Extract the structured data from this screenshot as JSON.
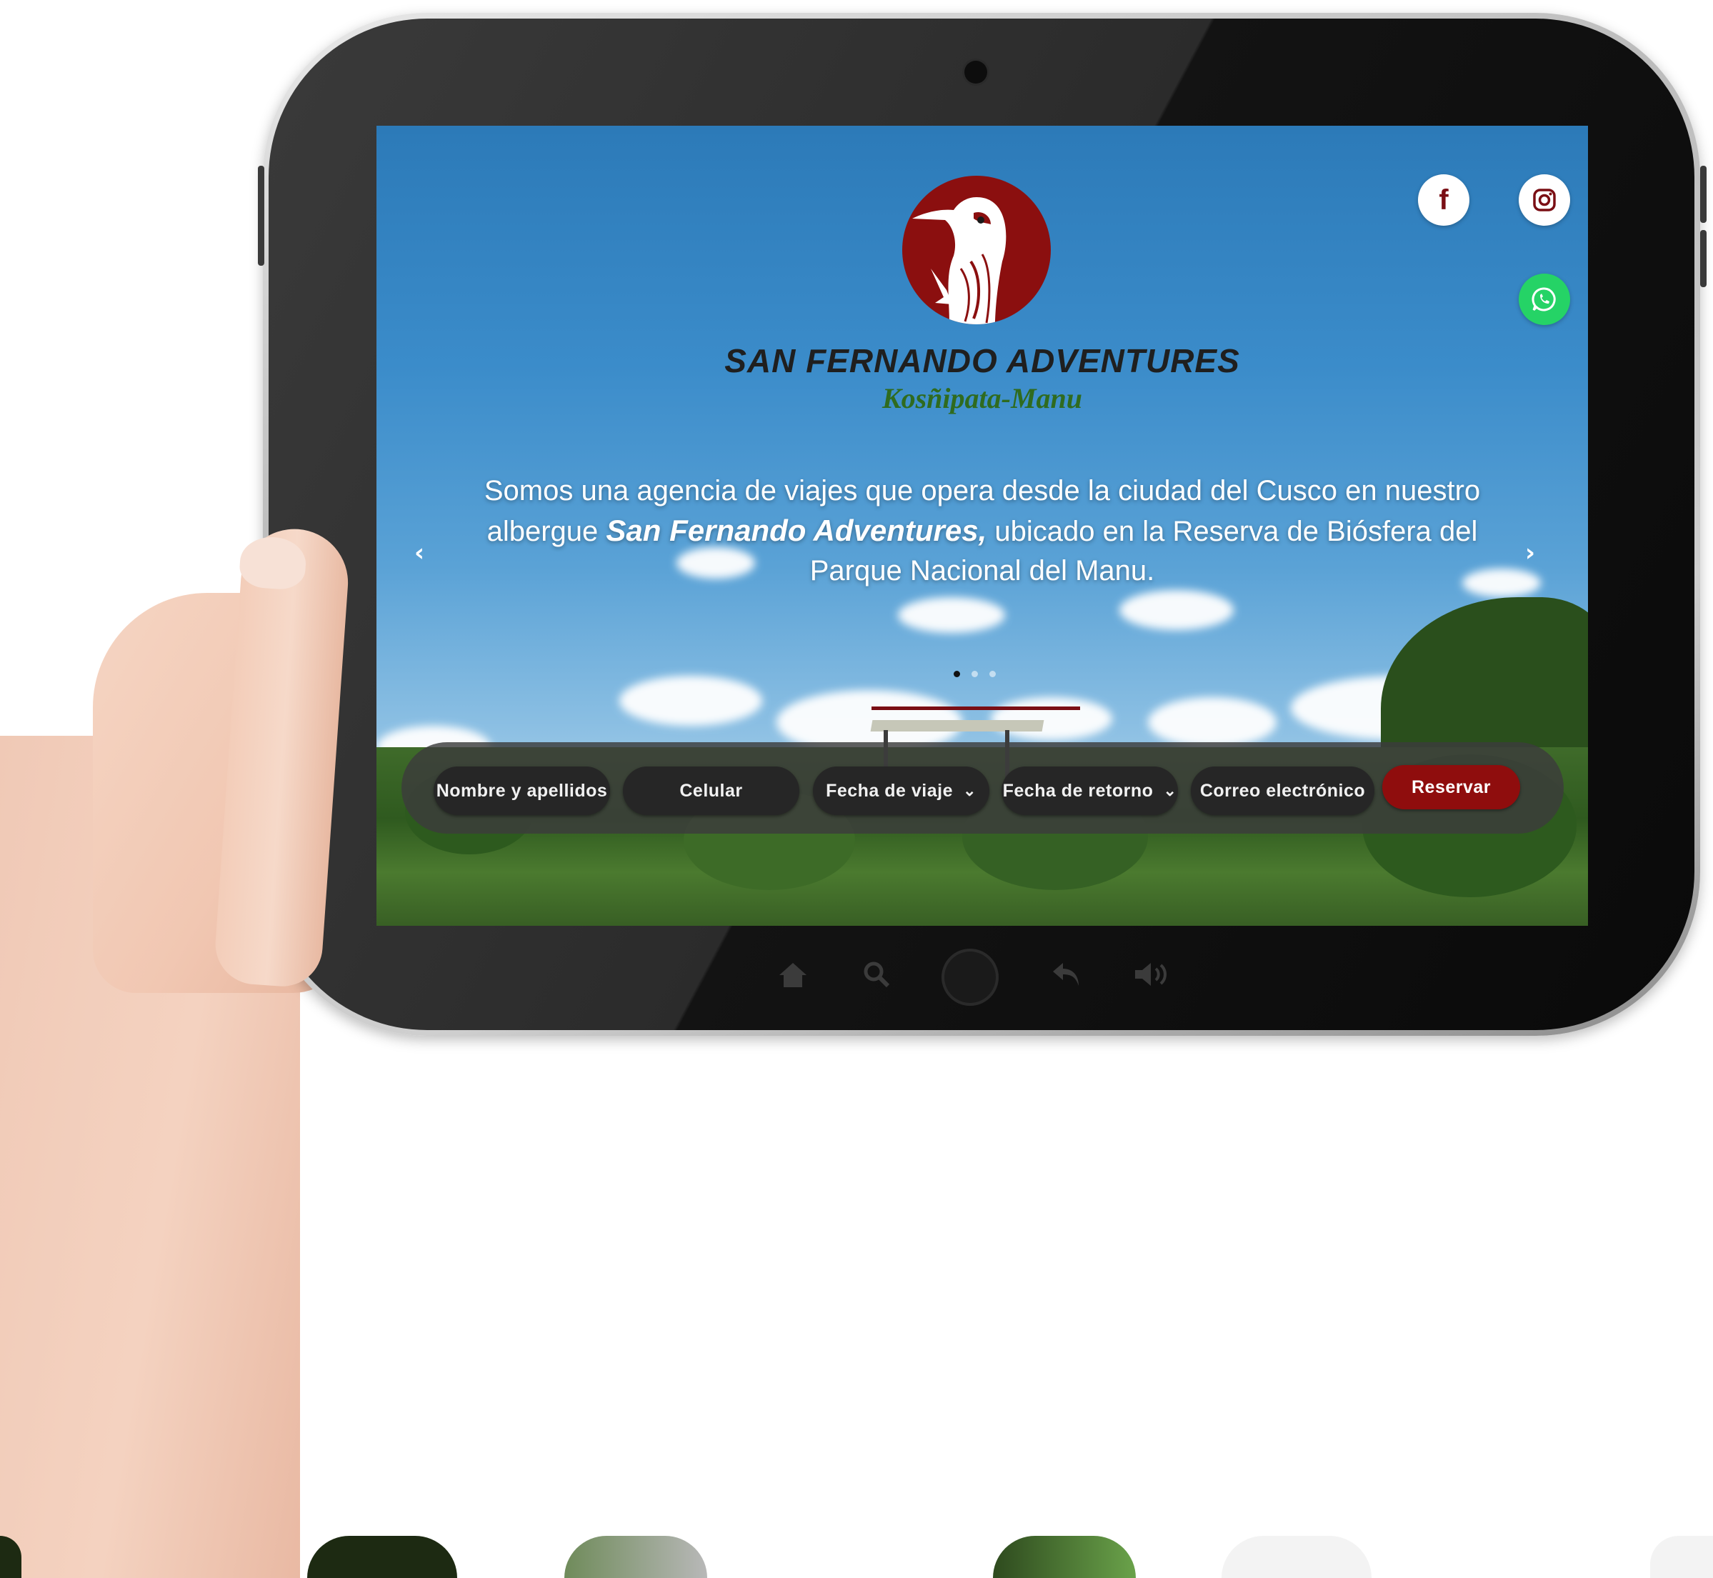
{
  "brand": {
    "name": "SAN FERNANDO ADVENTURES",
    "location": "Kosñipata-Manu"
  },
  "hero": {
    "intro_before": "Somos una agencia de viajes que opera desde la ciudad del Cusco en nuestro albergue ",
    "intro_highlight": "San Fernando Adventures,",
    "intro_after": " ubicado en la Reserva de Biósfera del Parque Nacional del Manu.",
    "prev_arrow": "‹",
    "next_arrow": "›",
    "slides_total": 3,
    "slide_active": 1
  },
  "social": {
    "facebook_glyph": "f",
    "instagram_icon": "instagram-icon",
    "whatsapp_icon": "whatsapp-icon"
  },
  "booking": {
    "name_field": "Nombre y apellidos",
    "phone_field": "Celular",
    "travel_date_field": "Fecha de viaje",
    "return_date_field": "Fecha de retorno",
    "email_field": "Correo electrónico",
    "submit_label": "Reservar",
    "chevron": "⌄"
  },
  "colors": {
    "brand_red": "#8b0f0f",
    "brand_green": "#2f6b1f",
    "whatsapp": "#25d366"
  }
}
